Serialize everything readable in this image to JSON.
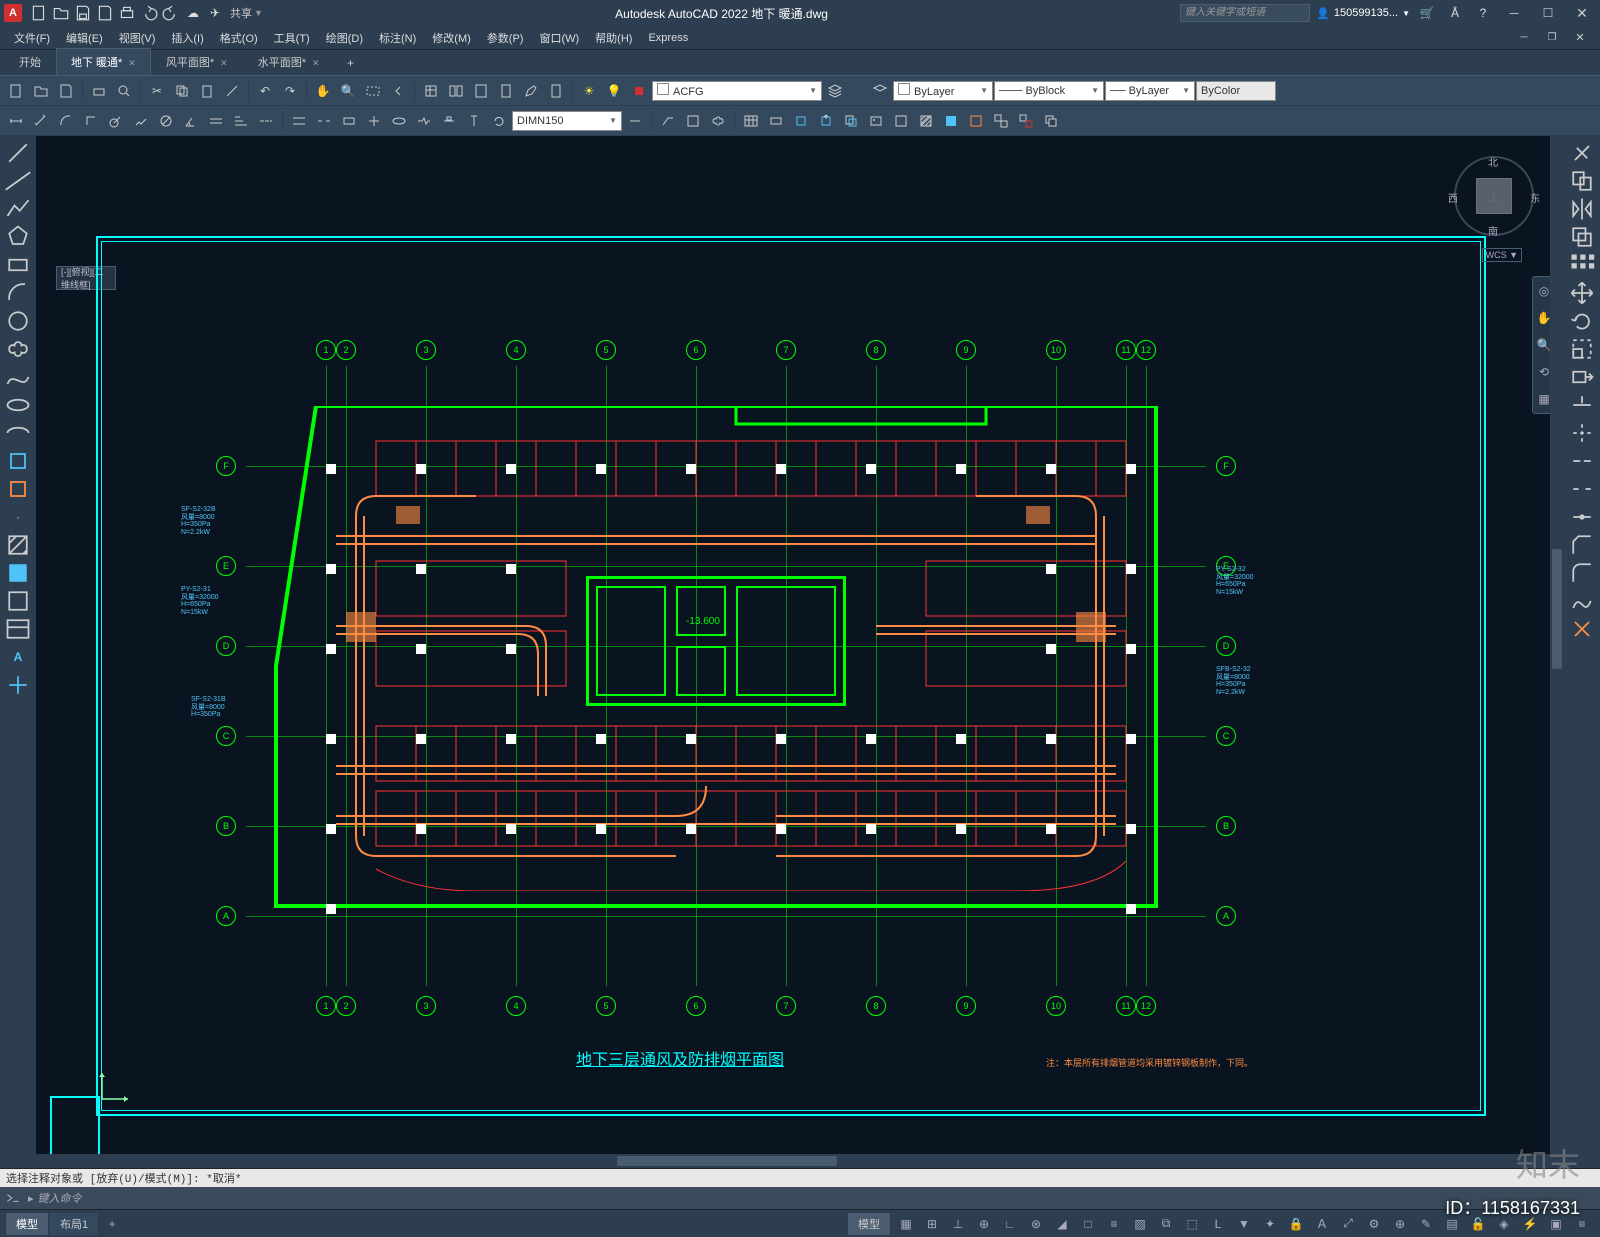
{
  "title_bar": {
    "app_logo": "A",
    "app_title": "Autodesk AutoCAD 2022   地下 暖通.dwg",
    "share_label": "共享",
    "search_placeholder": "键入关键字或短语",
    "username": "150599135...",
    "qat_icons": [
      "new",
      "open",
      "save",
      "saveas",
      "plot",
      "undo",
      "redo"
    ]
  },
  "menu": {
    "items": [
      "文件(F)",
      "编辑(E)",
      "视图(V)",
      "插入(I)",
      "格式(O)",
      "工具(T)",
      "绘图(D)",
      "标注(N)",
      "修改(M)",
      "参数(P)",
      "窗口(W)",
      "帮助(H)",
      "Express"
    ]
  },
  "ribbon_tabs": {
    "items": [
      {
        "label": "开始",
        "active": false,
        "closable": false
      },
      {
        "label": "地下 暖通*",
        "active": true,
        "closable": true
      },
      {
        "label": "风平面图*",
        "active": false,
        "closable": true
      },
      {
        "label": "水平面图*",
        "active": false,
        "closable": true
      }
    ]
  },
  "toolbar1": {
    "layer_combo": "ACFG",
    "layer_props": "ByLayer",
    "linetype": "ByBlock",
    "lineweight": "ByLayer",
    "color": "ByColor"
  },
  "toolbar2": {
    "dim_style": "DIMN150"
  },
  "drawing": {
    "wcs_label": "[-][俯视][二维线框]",
    "title": "地下三层通风及防排烟平面图",
    "note": "注：本层所有排烟管道均采用镀锌钢板制作，下同。",
    "level_elev": "-13.600",
    "grid_h": [
      "1",
      "2",
      "3",
      "4",
      "5",
      "6",
      "7",
      "8",
      "9",
      "10",
      "11",
      "12"
    ],
    "grid_v": [
      "A",
      "B",
      "C",
      "D",
      "E",
      "F"
    ],
    "viewcube": {
      "top": "上",
      "n": "北",
      "s": "南",
      "e": "东",
      "w": "西"
    }
  },
  "command": {
    "history": "选择注释对象或  [放弃(U)/模式(M)]:  *取消*",
    "prompt": "键入命令"
  },
  "status": {
    "tabs": [
      {
        "label": "模型",
        "active": true
      },
      {
        "label": "布局1",
        "active": false
      }
    ],
    "mode_label": "模型"
  },
  "watermark": {
    "id": "ID：1158167331",
    "logo": "知末"
  },
  "colors": {
    "bg": "#0a1420",
    "chrome": "#2c3e50",
    "cyan": "#00ffff",
    "green": "#00ff00",
    "orange": "#ff8c42",
    "red": "#ff3333"
  }
}
